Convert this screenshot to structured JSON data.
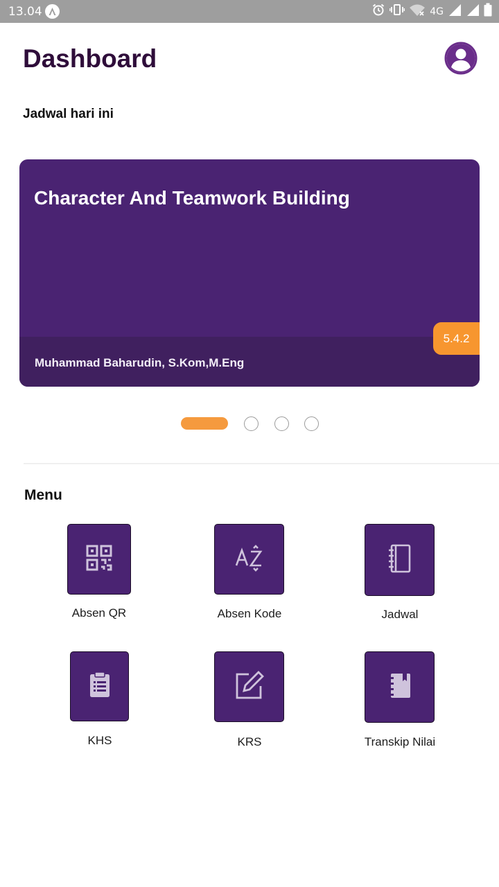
{
  "statusbar": {
    "time": "13.04",
    "network": "4G"
  },
  "header": {
    "title": "Dashboard",
    "subtitle": "Jadwal hari ini"
  },
  "schedule_card": {
    "course": "Character And Teamwork Building",
    "lecturer": "Muhammad Baharudin, S.Kom,M.Eng",
    "room": "5.4.2"
  },
  "pager": {
    "total": 4,
    "active_index": 0
  },
  "menu": {
    "title": "Menu",
    "items": [
      {
        "label": "Absen QR",
        "icon": "qr-code-icon"
      },
      {
        "label": "Absen Kode",
        "icon": "az-sort-icon"
      },
      {
        "label": "Jadwal",
        "icon": "notebook-icon"
      },
      {
        "label": "KHS",
        "icon": "clipboard-icon"
      },
      {
        "label": "KRS",
        "icon": "edit-icon"
      },
      {
        "label": "Transkip Nilai",
        "icon": "book-icon"
      }
    ]
  },
  "colors": {
    "primary": "#4a2372",
    "accent": "#f7962f",
    "title": "#2f0d3a"
  }
}
